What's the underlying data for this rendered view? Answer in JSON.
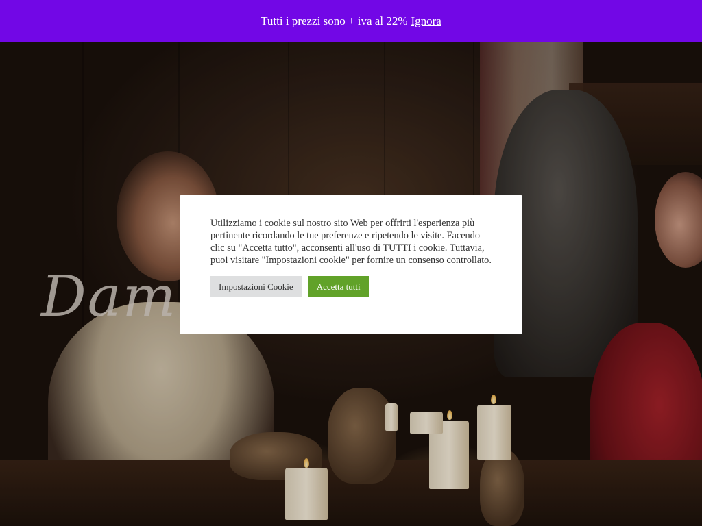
{
  "notice_bar": {
    "message": "Tutti i prezzi sono + iva al 22%",
    "dismiss_label": "Ignora",
    "background_color": "#7207e6"
  },
  "hero": {
    "title": "Dame"
  },
  "cookie_banner": {
    "message": "Utilizziamo i cookie sul nostro sito Web per offrirti l'esperienza più pertinente ricordando le tue preferenze e ripetendo le visite. Facendo clic su \"Accetta tutto\", acconsenti all'uso di TUTTI i cookie. Tuttavia, puoi visitare \"Impostazioni cookie\" per fornire un consenso controllato.",
    "settings_button_label": "Impostazioni Cookie",
    "accept_button_label": "Accetta tutti",
    "accept_color": "#61a229",
    "settings_color": "#dedfe0"
  }
}
